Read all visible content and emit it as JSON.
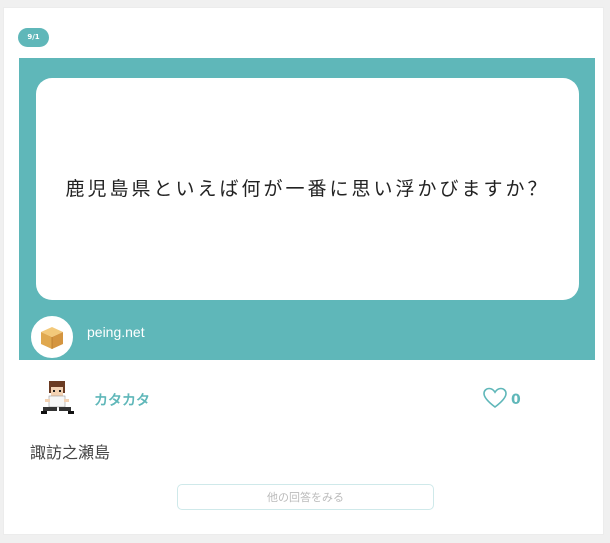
{
  "card": {
    "date_badge": "9/1",
    "question": {
      "text": "鹿児島県といえば何が一番に思い浮かびますか？"
    },
    "site": {
      "label": "peing.net",
      "avatar_icon": "cardboard-box-icon"
    },
    "answerer": {
      "name": "カタカタ",
      "avatar_icon": "pixel-character-icon"
    },
    "like": {
      "icon": "heart-outline-icon",
      "count": "0"
    },
    "answer": {
      "text": "諏訪之瀬島"
    },
    "more_button": {
      "label": "他の回答をみる"
    }
  },
  "colors": {
    "accent": "#5fb7b9",
    "background": "#f0f0f0",
    "card": "#ffffff"
  }
}
